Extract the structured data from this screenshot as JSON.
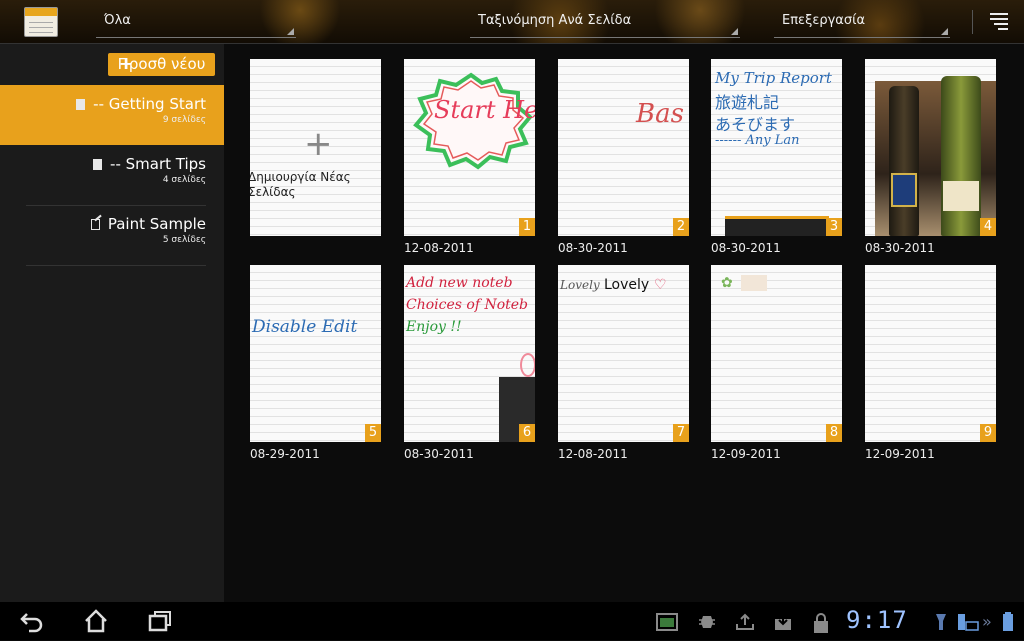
{
  "actionbar": {
    "filter_label": "Όλα",
    "sort_label": "Ταξινόμηση Ανά Σελίδα",
    "edit_label": "Επεξεργασία"
  },
  "sidebar": {
    "new_button": "Προσθ νέου",
    "notebooks": [
      {
        "title": "-- Getting Start",
        "count": "9 σελίδες",
        "active": true,
        "icon": "notebook-icon"
      },
      {
        "title": "-- Smart Tips",
        "count": "4 σελίδες",
        "active": false,
        "icon": "notebook-icon"
      },
      {
        "title": "Paint Sample",
        "count": "5 σελίδες",
        "active": false,
        "icon": "paint-notebook-icon"
      }
    ]
  },
  "create_page": {
    "label": "Δημιουργία Νέας Σελίδας"
  },
  "pages": [
    {
      "num": "1",
      "date": "12-08-2011",
      "content": "Start Here!"
    },
    {
      "num": "2",
      "date": "08-30-2011",
      "content": "Bas"
    },
    {
      "num": "3",
      "date": "08-30-2011",
      "content": "My Trip Report 旅遊札記 あそびます ------ Any Lan"
    },
    {
      "num": "4",
      "date": "08-30-2011",
      "content": "photo-bottles"
    },
    {
      "num": "5",
      "date": "08-29-2011",
      "content": "Disable Edit"
    },
    {
      "num": "6",
      "date": "08-30-2011",
      "content": "Add new noteb Choices of Noteb Enjoy !!"
    },
    {
      "num": "7",
      "date": "12-08-2011",
      "content": "Lovely Lovely"
    },
    {
      "num": "8",
      "date": "12-09-2011",
      "content": "flower-sketch"
    },
    {
      "num": "9",
      "date": "12-09-2011",
      "content": ""
    }
  ],
  "page_texts": {
    "p1": "Start Here!",
    "p2": "Bas",
    "p3_l1": "My Trip Report",
    "p3_l2": "旅遊札記",
    "p3_l3": "あそびます",
    "p3_l4": "------ Any Lan",
    "p5": "Disable Edit",
    "p6_l1": "Add new noteb",
    "p6_l2": "Choices of Noteb",
    "p6_l3": "Enjoy !!",
    "p7_a": "Lovely",
    "p7_b": "Lovely"
  },
  "sysbar": {
    "clock": "9:17"
  },
  "colors": {
    "accent": "#e8a11c",
    "sidebar_bg": "#1b1b1b",
    "clock": "#9fc3ff"
  }
}
